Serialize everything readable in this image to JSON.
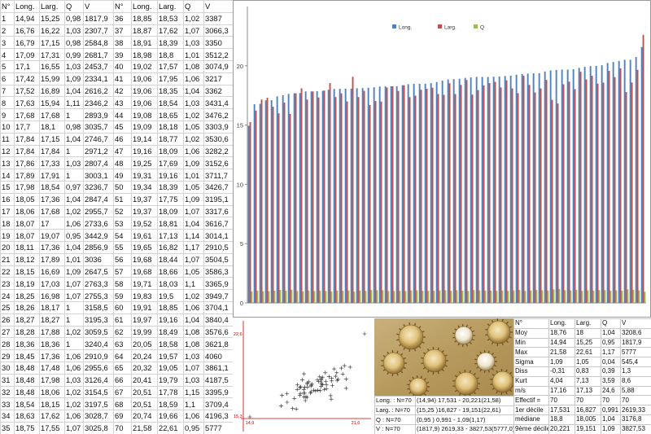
{
  "sheet": {
    "headers": [
      "N°",
      "Long.",
      "Larg.",
      "Q",
      "V",
      "N°",
      "Long.",
      "Larg.",
      "Q",
      "V"
    ],
    "rows": [
      [
        "1",
        "14,94",
        "15,25",
        "0,98",
        "1817,9",
        "36",
        "18,85",
        "18,53",
        "1,02",
        "3387"
      ],
      [
        "2",
        "16,76",
        "16,22",
        "1,03",
        "2307,7",
        "37",
        "18,87",
        "17,62",
        "1,07",
        "3066,3"
      ],
      [
        "3",
        "16,79",
        "17,15",
        "0,98",
        "2584,8",
        "38",
        "18,91",
        "18,39",
        "1,03",
        "3350"
      ],
      [
        "4",
        "17,09",
        "17,31",
        "0,99",
        "2681,7",
        "39",
        "18,98",
        "18,8",
        "1,01",
        "3512,2"
      ],
      [
        "5",
        "17,1",
        "16,55",
        "1,03",
        "2453,7",
        "40",
        "19,02",
        "17,57",
        "1,08",
        "3074,9"
      ],
      [
        "6",
        "17,42",
        "15,99",
        "1,09",
        "2334,1",
        "41",
        "19,06",
        "17,95",
        "1,06",
        "3217"
      ],
      [
        "7",
        "17,52",
        "16,89",
        "1,04",
        "2616,2",
        "42",
        "19,06",
        "18,35",
        "1,04",
        "3362"
      ],
      [
        "8",
        "17,63",
        "15,94",
        "1,11",
        "2346,2",
        "43",
        "19,06",
        "18,54",
        "1,03",
        "3431,4"
      ],
      [
        "9",
        "17,68",
        "17,68",
        "1",
        "2893,9",
        "44",
        "19,08",
        "18,65",
        "1,02",
        "3476,2"
      ],
      [
        "10",
        "17,7",
        "18,1",
        "0,98",
        "3035,7",
        "45",
        "19,09",
        "18,18",
        "1,05",
        "3303,9"
      ],
      [
        "11",
        "17,84",
        "17,15",
        "1,04",
        "2746,7",
        "46",
        "19,14",
        "18,77",
        "1,02",
        "3530,6"
      ],
      [
        "12",
        "17,84",
        "17,84",
        "1",
        "2971,2",
        "47",
        "19,16",
        "18,09",
        "1,06",
        "3282,2"
      ],
      [
        "13",
        "17,86",
        "17,33",
        "1,03",
        "2807,4",
        "48",
        "19,25",
        "17,69",
        "1,09",
        "3152,6"
      ],
      [
        "14",
        "17,89",
        "17,91",
        "1",
        "3003,1",
        "49",
        "19,31",
        "19,16",
        "1,01",
        "3711,7"
      ],
      [
        "15",
        "17,98",
        "18,54",
        "0,97",
        "3236,7",
        "50",
        "19,34",
        "18,39",
        "1,05",
        "3426,7"
      ],
      [
        "16",
        "18,05",
        "17,36",
        "1,04",
        "2847,4",
        "51",
        "19,37",
        "17,75",
        "1,09",
        "3195,1"
      ],
      [
        "17",
        "18,06",
        "17,68",
        "1,02",
        "2955,7",
        "52",
        "19,37",
        "18,09",
        "1,07",
        "3317,6"
      ],
      [
        "18",
        "18,07",
        "17",
        "1,06",
        "2733,6",
        "53",
        "19,52",
        "18,81",
        "1,04",
        "3616,7"
      ],
      [
        "19",
        "18,07",
        "19,07",
        "0,95",
        "3442,9",
        "54",
        "19,61",
        "17,13",
        "1,14",
        "3014,1"
      ],
      [
        "20",
        "18,11",
        "17,36",
        "1,04",
        "2856,9",
        "55",
        "19,65",
        "16,82",
        "1,17",
        "2910,5"
      ],
      [
        "21",
        "18,12",
        "17,89",
        "1,01",
        "3036",
        "56",
        "19,68",
        "18,44",
        "1,07",
        "3504,5"
      ],
      [
        "22",
        "18,15",
        "16,69",
        "1,09",
        "2647,5",
        "57",
        "19,68",
        "18,66",
        "1,05",
        "3586,3"
      ],
      [
        "23",
        "18,19",
        "17,03",
        "1,07",
        "2763,3",
        "58",
        "19,71",
        "18,03",
        "1,1",
        "3365,9"
      ],
      [
        "24",
        "18,25",
        "16,98",
        "1,07",
        "2755,3",
        "59",
        "19,83",
        "19,5",
        "1,02",
        "3949,7"
      ],
      [
        "25",
        "18,26",
        "18,17",
        "1",
        "3158,5",
        "60",
        "19,91",
        "18,85",
        "1,06",
        "3704,1"
      ],
      [
        "26",
        "18,27",
        "18,27",
        "1",
        "3195,3",
        "61",
        "19,97",
        "19,16",
        "1,04",
        "3840,4"
      ],
      [
        "27",
        "18,28",
        "17,88",
        "1,02",
        "3059,5",
        "62",
        "19,99",
        "18,49",
        "1,08",
        "3576,6"
      ],
      [
        "28",
        "18,36",
        "18,36",
        "1",
        "3240,4",
        "63",
        "20,05",
        "18,58",
        "1,08",
        "3621,8"
      ],
      [
        "29",
        "18,45",
        "17,36",
        "1,06",
        "2910,9",
        "64",
        "20,24",
        "19,57",
        "1,03",
        "4060"
      ],
      [
        "30",
        "18,48",
        "17,48",
        "1,06",
        "2955,6",
        "65",
        "20,32",
        "19,05",
        "1,07",
        "3861,1"
      ],
      [
        "31",
        "18,48",
        "17,98",
        "1,03",
        "3126,4",
        "66",
        "20,41",
        "19,79",
        "1,03",
        "4187,5"
      ],
      [
        "32",
        "18,48",
        "18,06",
        "1,02",
        "3154,5",
        "67",
        "20,51",
        "17,78",
        "1,15",
        "3395,9"
      ],
      [
        "33",
        "18,54",
        "18,15",
        "1,02",
        "3197,5",
        "68",
        "20,51",
        "18,59",
        "1,1",
        "3709,4"
      ],
      [
        "34",
        "18,63",
        "17,62",
        "1,06",
        "3028,7",
        "69",
        "20,74",
        "19,66",
        "1,06",
        "4196,3"
      ],
      [
        "35",
        "18,75",
        "17,55",
        "1,07",
        "3025,8",
        "70",
        "21,58",
        "22,61",
        "0,95",
        "5777"
      ]
    ]
  },
  "summary_lines": [
    [
      "Long. : N=70",
      "(14,94) 17,531 - 20,221(21,58)"
    ],
    [
      "Larg. : N=70",
      "(15,25 )16,827 - 19,151(22,61)"
    ],
    [
      "Q : N=70",
      "(0,95 ) 0,991 - 1,09(1,17)"
    ],
    [
      "V : N=70",
      "(1817,9) 2619,33 - 3827,53(5777,0)"
    ]
  ],
  "stats": {
    "headers": [
      "N°",
      "Long.",
      "Larg.",
      "Q",
      "V"
    ],
    "rows": [
      [
        "Moy",
        "18,76",
        "18",
        "1,04",
        "3208,6"
      ],
      [
        "Min",
        "14,94",
        "15,25",
        "0,95",
        "1817,9"
      ],
      [
        "Max",
        "21,58",
        "22,61",
        "1,17",
        "5777"
      ],
      [
        "Sigma",
        "1,09",
        "1,05",
        "0,04",
        "545,4"
      ],
      [
        "Diss",
        "-0,31",
        "0,83",
        "0,39",
        "1,3"
      ],
      [
        "Kurt",
        "4,04",
        "7,13",
        "3,59",
        "8,6"
      ],
      [
        "m/s",
        "17,16",
        "17,13",
        "24,6",
        "5,88"
      ],
      [
        "Effectif =",
        "70",
        "70",
        "70",
        "70"
      ],
      [
        "1er décile",
        "17,531",
        "16,827",
        "0,991",
        "2619,33"
      ],
      [
        "médiane",
        "18,8",
        "18,005",
        "1,04",
        "3176,8"
      ],
      [
        "9ème décile",
        "20,221",
        "19,151",
        "1,09",
        "3827,53"
      ]
    ]
  },
  "photo": {
    "spore_icon": "spore-micrograph-icon"
  },
  "colors": {
    "long": "#4f81bd",
    "larg": "#c0504d",
    "q": "#9bbb59",
    "axis": "#888888",
    "scatter_axis": "#cc0000"
  },
  "chart_data": [
    {
      "type": "bar",
      "legend_position": "top",
      "grid": false,
      "ylim": [
        0,
        25
      ],
      "yticks": [
        "0",
        "5",
        "10",
        "15",
        "20"
      ],
      "series_sources": {
        "Long.": 1,
        "Larg.": 2,
        "Q": 3
      },
      "series_names": [
        "Long.",
        "Larg.",
        "Q"
      ]
    },
    {
      "type": "scatter",
      "x_source_column": 1,
      "y_source_column": 2,
      "xlim": [
        14.94,
        21.58
      ],
      "ylim": [
        15.25,
        22.61
      ],
      "xmin_label": "14,9",
      "xmax_label": "21,6",
      "ymin_label": "15,3",
      "ymax_label": "22,6"
    }
  ]
}
